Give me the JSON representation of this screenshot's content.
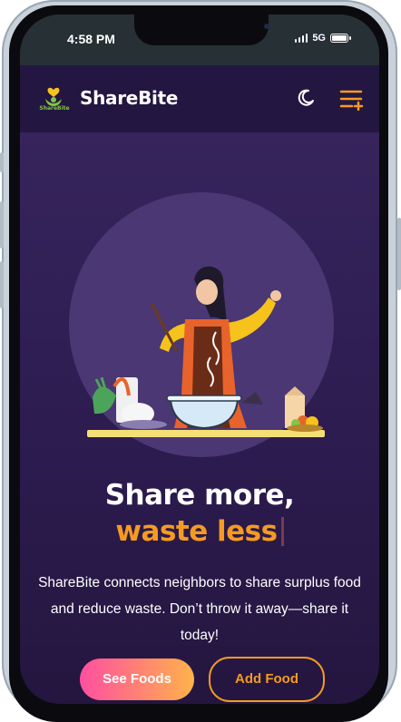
{
  "status_bar": {
    "time": "4:58 PM",
    "network": "5G"
  },
  "header": {
    "logo_text": "ShareBite",
    "brand": "ShareBite",
    "theme_icon": "moon-icon",
    "menu_icon": "menu-plus-icon"
  },
  "hero": {
    "headline_line1": "Share more,",
    "headline_line2": "waste less",
    "description": "ShareBite connects neighbors to share surplus food and reduce waste. Don’t throw it away—share it today!",
    "primary_button": "See Foods",
    "secondary_button": "Add Food"
  },
  "colors": {
    "accent_orange": "#f59b22",
    "background": "#2c1b4e",
    "header": "#231641"
  }
}
